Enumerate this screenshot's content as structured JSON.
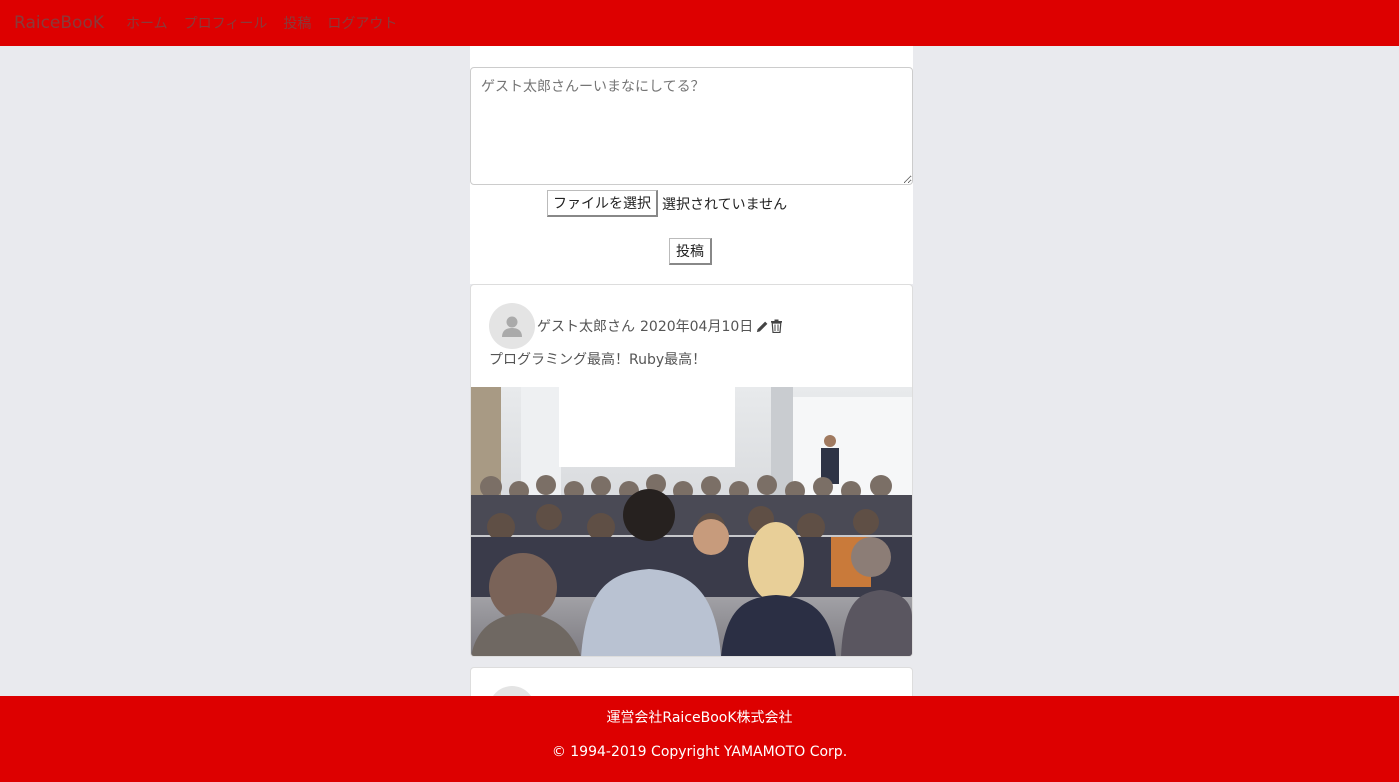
{
  "nav": {
    "brand": "RaiceBooK",
    "links": [
      "ホーム",
      "プロフィール",
      "投稿",
      "ログアウト"
    ]
  },
  "composer": {
    "placeholder": "ゲスト太郎さんーいまなにしてる？",
    "file_button": "ファイルを選択",
    "file_status": "選択されていません",
    "submit": "投稿"
  },
  "post": {
    "author": "ゲスト太郎さん",
    "date": "2020年04月10日",
    "body": "プログラミング最高！Ruby最高！",
    "icons": [
      "pencil-icon",
      "trash-icon"
    ],
    "image": "audience-at-conference-photo"
  },
  "footer": {
    "company": "運営会社RaiceBooK株式会社",
    "copyright": "© 1994-2019 Copyright YAMAMOTO Corp."
  },
  "colors": {
    "brand_red": "#dd0000",
    "page_bg": "#e9eaee"
  }
}
